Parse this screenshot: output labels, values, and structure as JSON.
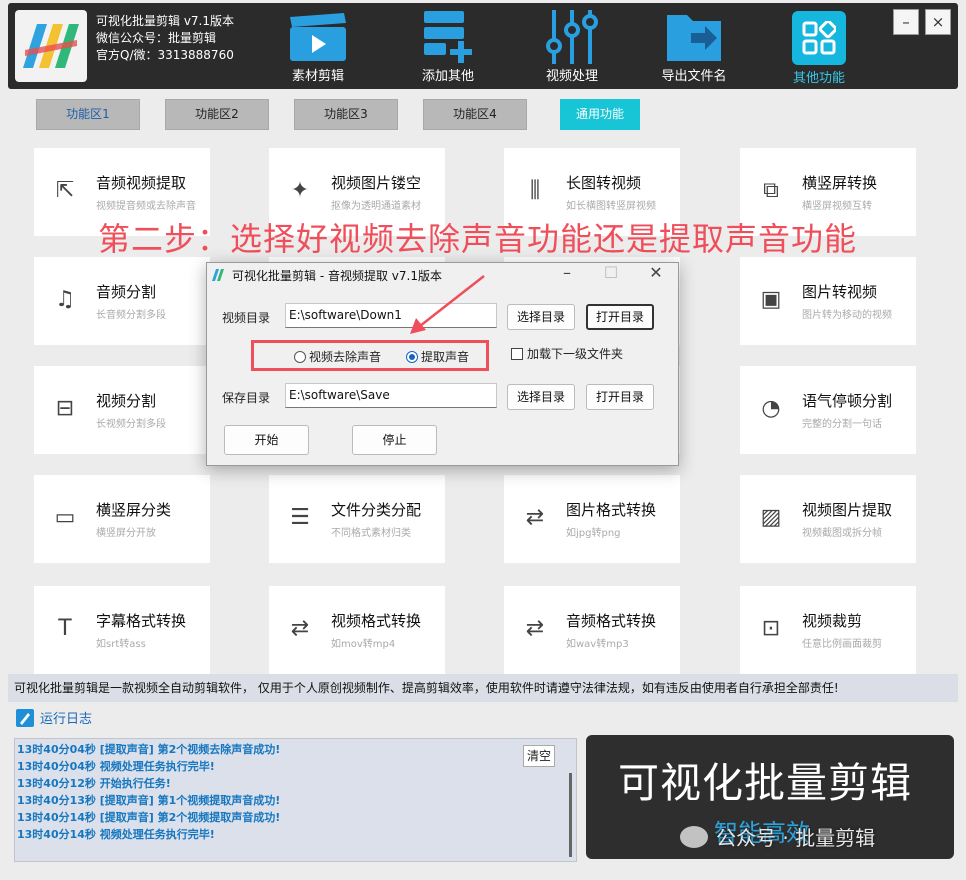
{
  "app": {
    "name": "可视化批量剪辑 v7.1版本",
    "wechat": "微信公众号：批量剪辑",
    "qq": "官方Q/微：3313888760"
  },
  "toolbar": [
    {
      "label": "素材剪辑",
      "icon": "clapper-icon"
    },
    {
      "label": "添加其他",
      "icon": "add-list-icon"
    },
    {
      "label": "视频处理",
      "icon": "sliders-icon"
    },
    {
      "label": "导出文件名",
      "icon": "export-folder-icon"
    },
    {
      "label": "其他功能",
      "icon": "grid-apps-icon"
    }
  ],
  "window_controls": {
    "minimize": "–",
    "close": "×"
  },
  "tabs": [
    "功能区1",
    "功能区2",
    "功能区3",
    "功能区4",
    "通用功能"
  ],
  "cards": [
    {
      "title": "音频视频提取",
      "sub": "视频提音频或去除声音"
    },
    {
      "title": "视频图片镂空",
      "sub": "抠像为透明通道素材"
    },
    {
      "title": "长图转视频",
      "sub": "如长横图转竖屏视频"
    },
    {
      "title": "横竖屏转换",
      "sub": "横竖屏视频互转"
    },
    {
      "title": "音频分割",
      "sub": "长音频分割多段"
    },
    {
      "title": "图片转视频",
      "sub": "图片转为移动的视频"
    },
    {
      "title": "视频分割",
      "sub": "长视频分割多段"
    },
    {
      "title": "语气停顿分割",
      "sub": "完整的分割一句话"
    },
    {
      "title": "横竖屏分类",
      "sub": "横竖屏分开放"
    },
    {
      "title": "文件分类分配",
      "sub": "不同格式素材归类"
    },
    {
      "title": "图片格式转换",
      "sub": "如jpg转png"
    },
    {
      "title": "视频图片提取",
      "sub": "视频截图或拆分帧"
    },
    {
      "title": "字幕格式转换",
      "sub": "如srt转ass"
    },
    {
      "title": "视频格式转换",
      "sub": "如mov转mp4"
    },
    {
      "title": "音频格式转换",
      "sub": "如wav转mp3"
    },
    {
      "title": "视频裁剪",
      "sub": "任意比例画面裁剪"
    }
  ],
  "overlay_instruction": "第二步：选择好视频去除声音功能还是提取声音功能",
  "dialog": {
    "title": "可视化批量剪辑 - 音视频提取  v7.1版本",
    "video_dir_label": "视频目录",
    "video_dir_value": "E:\\software\\Down1",
    "select_dir": "选择目录",
    "open_dir": "打开目录",
    "radio_remove": "视频去除声音",
    "radio_extract": "提取声音",
    "radio_selected": "提取声音",
    "load_subfolder": "加载下一级文件夹",
    "save_dir_label": "保存目录",
    "save_dir_value": "E:\\software\\Save",
    "start": "开始",
    "stop": "停止"
  },
  "disclaimer": "可视化批量剪辑是一款视频全自动剪辑软件， 仅用于个人原创视频制作、提高剪辑效率，使用软件时请遵守法律法规，如有违反由使用者自行承担全部责任!",
  "log": {
    "title": "运行日志",
    "clear": "清空",
    "lines": [
      "13时40分04秒 [提取声音] 第2个视频去除声音成功!",
      "13时40分04秒 视频处理任务执行完毕!",
      "13时40分12秒 开始执行任务!",
      "13时40分13秒 [提取声音] 第1个视频提取声音成功!",
      "13时40分14秒 [提取声音] 第2个视频提取声音成功!",
      "13时40分14秒 视频处理任务执行完毕!"
    ]
  },
  "promo": {
    "big": "可视化批量剪辑",
    "small": "智能高效"
  },
  "watermark": "公众号 · 批量剪辑",
  "colors": {
    "accent": "#18c5d6",
    "highlight": "#ef4f5a",
    "log_text": "#1577c0"
  }
}
